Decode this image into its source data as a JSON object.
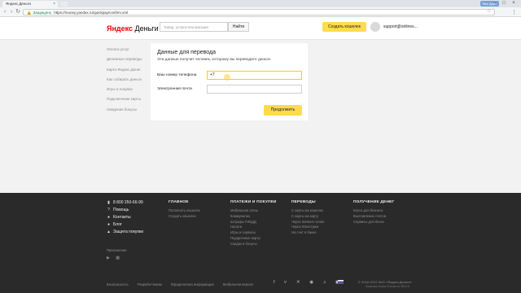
{
  "browser": {
    "tab_title": "Яндекс.Деньги",
    "tab_close": "×",
    "user_chip": "Вес Дорт",
    "address": {
      "secure_label": "Защищено",
      "url": "https://money.yandex.ru/quickpay/confirm.xml"
    },
    "window_controls": [
      "–",
      "□",
      "×"
    ]
  },
  "header": {
    "logo_brand": "Яндекс",
    "logo_product": "Деньги",
    "search_placeholder": "Товар, услуга или магазин",
    "search_button": "Найти",
    "create_wallet_button": "Создать кошелек",
    "user_email": "support@onlines..."
  },
  "sidebar": {
    "items": [
      "Оплата услуг",
      "Денежные переводы",
      "Карта Яндекс.Денег",
      "Как собирать деньги",
      "Игры и покупки",
      "Подключение карты",
      "Сведения бонусы"
    ]
  },
  "form": {
    "title": "Данные для перевода",
    "subtitle": "Эти данные получит человек, которому вы переводите деньги.",
    "phone_label": "Ваш номер телефона",
    "phone_value": "+7",
    "email_label": "Электронная почта",
    "email_value": "",
    "continue_button": "Продолжить"
  },
  "footer": {
    "contacts": [
      {
        "icon": "phone-icon",
        "glyph": "▮",
        "text": "8 800 250-66-99"
      },
      {
        "icon": "help-icon",
        "glyph": "?",
        "text": "Помощь"
      },
      {
        "icon": "contacts-icon",
        "glyph": "●",
        "text": "Контакты"
      },
      {
        "icon": "blog-icon",
        "glyph": "●",
        "text": "Блог"
      },
      {
        "icon": "shield-icon",
        "glyph": "▲",
        "text": "Защита покупки"
      }
    ],
    "apps_label": "Приложения",
    "apps_icons": "  ▶ ▦",
    "columns": [
      {
        "title": "ГЛАВНОЕ",
        "links": [
          "Пополнить кошелек",
          "Создать кошелек"
        ]
      },
      {
        "title": "ПЛАТЕЖИ И ПОКУПКИ",
        "links": [
          "Мобильная связь",
          "Коммуналка",
          "Штрафы ГИБДД",
          "Налоги",
          "Игры и сервисы",
          "Подарочные карты",
          "Скидки и бонусы"
        ]
      },
      {
        "title": "ПЕРЕВОДЫ",
        "links": [
          "С карты на кошелек",
          "С карты на карту",
          "Через Western Union",
          "Через Юнистрим",
          "На счет в банке"
        ]
      },
      {
        "title": "ПОЛУЧЕНИЕ ДЕНЕГ",
        "links": [
          "Касса для бизнеса",
          "Выставление счетов",
          "Сервисы для блога"
        ]
      }
    ],
    "bottom_links": [
      "Безопасность",
      "Разработчикам",
      "Юридическая информация",
      "Мобильная версия"
    ],
    "socials": "f ѵ ✕ ◉ ♫ ◼",
    "copyright": "© 2018 ООО НКО «Яндекс.Деньги»",
    "license": "Лицензия Банка России № 3510-К"
  }
}
